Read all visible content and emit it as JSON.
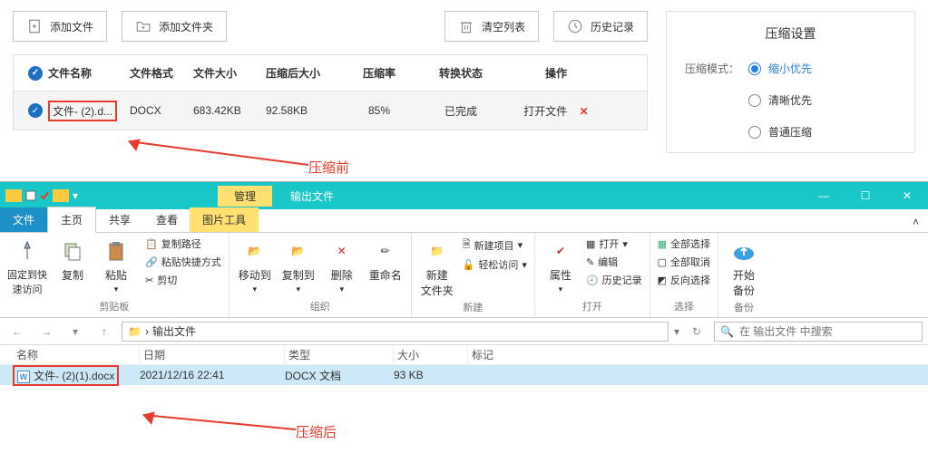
{
  "toolbar": {
    "add_file": "添加文件",
    "add_folder": "添加文件夹",
    "clear_list": "清空列表",
    "history": "历史记录"
  },
  "table": {
    "headers": {
      "name": "文件名称",
      "format": "文件格式",
      "size": "文件大小",
      "csize": "压缩后大小",
      "rate": "压缩率",
      "status": "转换状态",
      "op": "操作"
    },
    "row": {
      "name": "文件- (2).d...",
      "format": "DOCX",
      "size": "683.42KB",
      "csize": "92.58KB",
      "rate": "85%",
      "status": "已完成",
      "open": "打开文件"
    }
  },
  "settings": {
    "title": "压缩设置",
    "mode_label": "压缩模式：",
    "options": {
      "small": "缩小优先",
      "clear": "清晰优先",
      "normal": "普通压缩"
    }
  },
  "annotations": {
    "before": "压缩前",
    "after": "压缩后"
  },
  "explorer": {
    "manage": "管理",
    "window_title": "输出文件",
    "tabs": {
      "file": "文件",
      "home": "主页",
      "share": "共享",
      "view": "查看",
      "pictools": "图片工具"
    },
    "ribbon": {
      "pin": "固定到快\n速访问",
      "copy": "复制",
      "paste": "粘贴",
      "copy_path": "复制路径",
      "paste_shortcut": "粘贴快捷方式",
      "cut": "剪切",
      "group_clipboard": "剪贴板",
      "move_to": "移动到",
      "copy_to": "复制到",
      "delete": "删除",
      "rename": "重命名",
      "group_organize": "组织",
      "new_folder": "新建\n文件夹",
      "new_item": "新建项目",
      "easy_access": "轻松访问",
      "group_new": "新建",
      "properties": "属性",
      "open": "打开",
      "edit": "编辑",
      "history": "历史记录",
      "group_open": "打开",
      "select_all": "全部选择",
      "select_none": "全部取消",
      "invert": "反向选择",
      "group_select": "选择",
      "backup": "开始\n备份",
      "group_backup": "备份"
    },
    "path": "输出文件",
    "search_placeholder": "在 输出文件 中搜索",
    "columns": {
      "name": "名称",
      "date": "日期",
      "type": "类型",
      "size": "大小",
      "tag": "标记"
    },
    "file": {
      "name": "文件- (2)(1).docx",
      "date": "2021/12/16 22:41",
      "type": "DOCX 文档",
      "size": "93 KB"
    }
  }
}
